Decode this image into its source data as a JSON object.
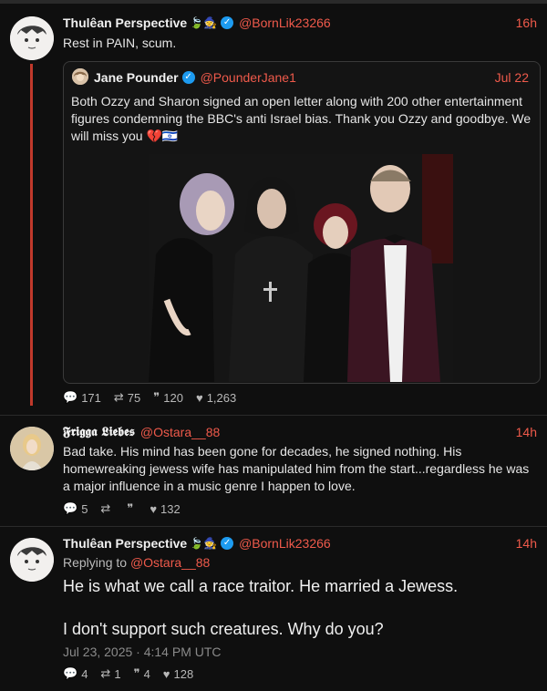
{
  "tweet1": {
    "name": "Thulêan Perspective",
    "name_emojis": "🍃🧙",
    "handle": "@BornLik23266",
    "time": "16h",
    "text": "Rest in PAIN, scum.",
    "quote": {
      "name": "Jane Pounder",
      "handle": "@PounderJane1",
      "time": "Jul 22",
      "text": "Both Ozzy and Sharon signed an open letter along with 200 other entertainment figures condemning the BBC's anti Israel bias. Thank you Ozzy and goodbye. We will miss you 💔🇮🇱"
    },
    "stats": {
      "replies": "171",
      "retweets": "75",
      "quotes": "120",
      "likes": "1,263"
    }
  },
  "tweet2": {
    "name": "𝕱𝖗𝖎𝖌𝖌𝖆 𝕷𝖎𝖊𝖇𝖊𝖘",
    "handle": "@Ostara__88",
    "time": "14h",
    "text": "Bad take. His mind has been gone for decades, he signed nothing. His homewreaking jewess wife has manipulated him from the start...regardless he was a major influence in a music genre I happen to love.",
    "stats": {
      "replies": "5",
      "retweets": "",
      "quotes": "",
      "likes": "132"
    }
  },
  "tweet3": {
    "name": "Thulêan Perspective",
    "name_emojis": "🍃🧙",
    "handle": "@BornLik23266",
    "time": "14h",
    "replying_label": "Replying to",
    "replying_handle": "@Ostara__88",
    "line1": "He is what we call a race traitor. He married a Jewess.",
    "line2": "I don't support such creatures. Why do you?",
    "date": "Jul 23, 2025 · 4:14 PM UTC",
    "stats": {
      "replies": "4",
      "retweets": "1",
      "quotes": "4",
      "likes": "128"
    }
  },
  "colors": {
    "accent": "#ef5a4b",
    "thread": "#c0392b",
    "verified": "#1d9bf0"
  },
  "icons": {
    "reply": "comment-icon",
    "retweet": "retweet-icon",
    "quote": "quote-icon",
    "like": "heart-icon",
    "verified": "verified-badge-icon"
  }
}
